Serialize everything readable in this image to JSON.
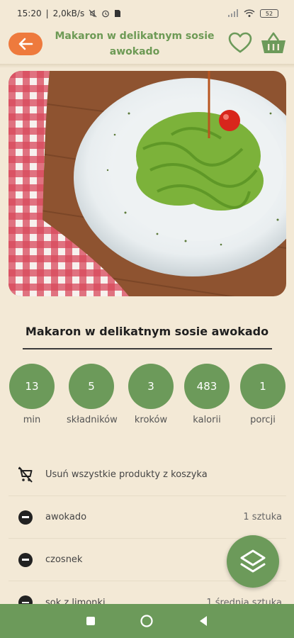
{
  "status": {
    "time": "15:20",
    "speed": "2,0kB/s",
    "battery": "52"
  },
  "header": {
    "title": "Makaron w delikatnym sosie awokado"
  },
  "recipe": {
    "title": "Makaron w delikatnym sosie awokado"
  },
  "stats": [
    {
      "value": "13",
      "label": "min"
    },
    {
      "value": "5",
      "label": "składników"
    },
    {
      "value": "3",
      "label": "kroków"
    },
    {
      "value": "483",
      "label": "kalorii"
    },
    {
      "value": "1",
      "label": "porcji"
    }
  ],
  "cart": {
    "remove_all_label": "Usuń wszystkie produkty z koszyka"
  },
  "ingredients": [
    {
      "name": "awokado",
      "qty": "1 sztuka"
    },
    {
      "name": "czosnek",
      "qty": ""
    },
    {
      "name": "sok z limonki",
      "qty": "1 średnia sztuka"
    }
  ],
  "colors": {
    "background": "#f3e9d6",
    "accent_green": "#6c9a5a",
    "back_orange": "#ee7a3d"
  },
  "icons": {
    "back": "arrow-left-icon",
    "favorite": "heart-icon",
    "basket": "basket-icon",
    "remove_cart": "cart-remove-icon",
    "remove_item": "minus-circle-icon",
    "fab": "layers-icon"
  }
}
